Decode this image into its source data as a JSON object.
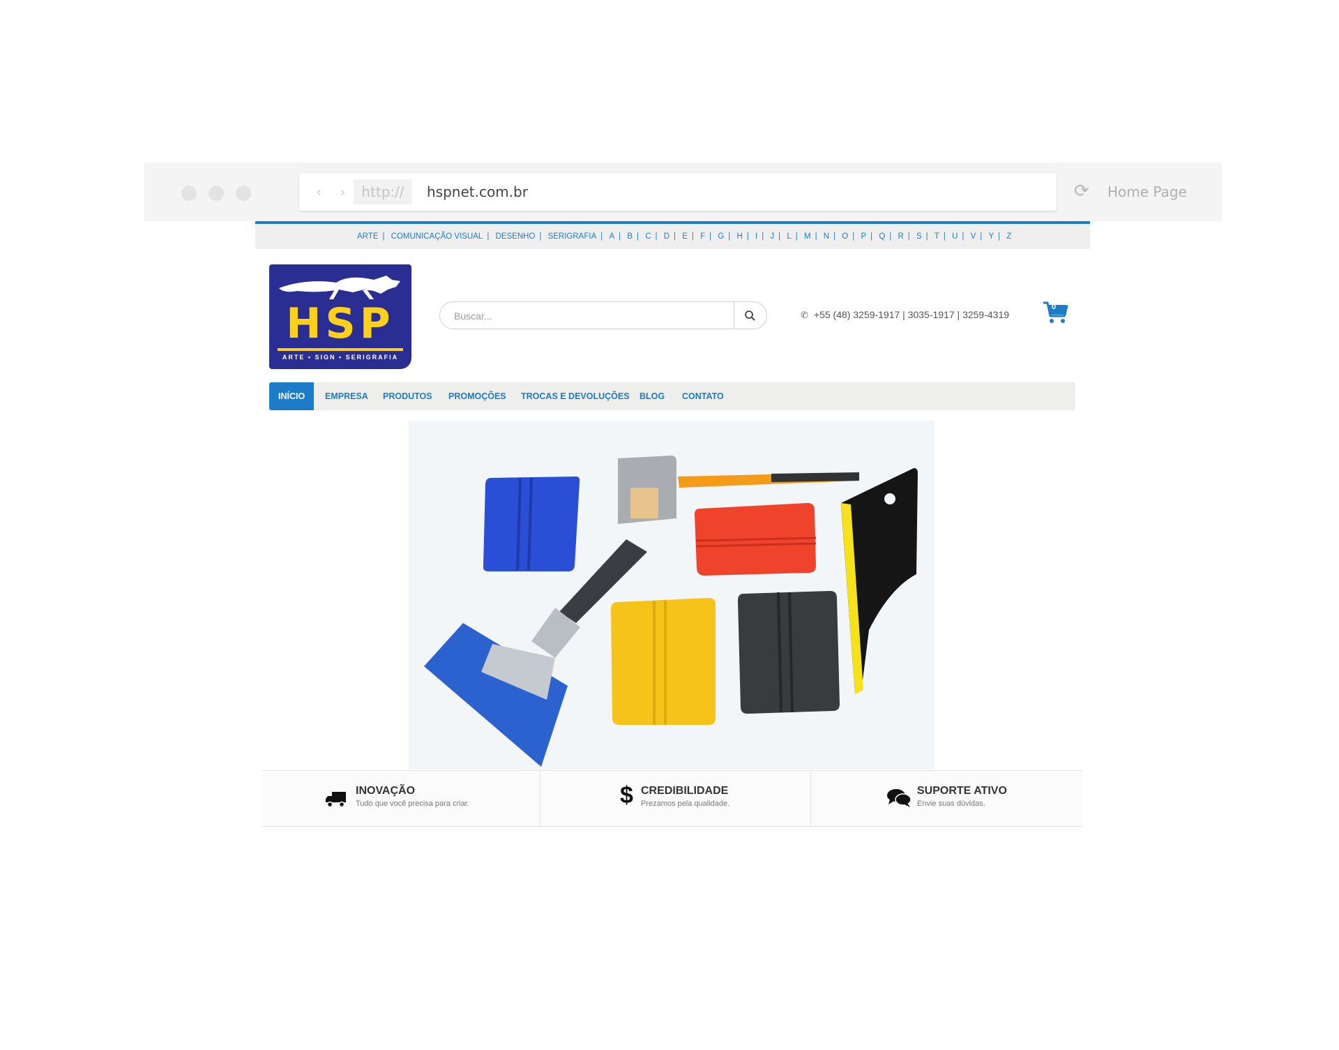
{
  "browser": {
    "nav_arrows": "‹ ›",
    "protocol": "http://",
    "url": "hspnet.com.br",
    "home_label": "Home Page"
  },
  "top_menu": {
    "items": [
      "ARTE",
      "COMUNICAÇÃO VISUAL",
      "DESENHO",
      "SERIGRAFIA",
      "A",
      "B",
      "C",
      "D",
      "E",
      "F",
      "G",
      "H",
      "I",
      "J",
      "L",
      "M",
      "N",
      "O",
      "P",
      "Q",
      "R",
      "S",
      "T",
      "U",
      "V",
      "Y",
      "Z"
    ],
    "color": "#1c7cc7"
  },
  "logo": {
    "text": "HSP",
    "subtitle": "ARTE • SIGN • SERIGRAFIA",
    "bg_color": "#2a2d92",
    "accent_color": "#ffd11c"
  },
  "search": {
    "placeholder": "Buscar...",
    "icon": "search-icon"
  },
  "contact": {
    "phone": "+55 (48) 3259-1917 | 3035-1917 | 3259-4319",
    "icon": "phone-icon"
  },
  "cart": {
    "count": "0",
    "icon": "shopping-cart-icon"
  },
  "main_nav": {
    "items": [
      "INÍCIO",
      "EMPRESA",
      "PRODUTOS",
      "PROMOÇÕES",
      "TROCAS E DEVOLUÇÕES",
      "BLOG",
      "CONTATO"
    ],
    "active": "INÍCIO"
  },
  "features": [
    {
      "title": "INOVAÇÃO",
      "subtitle": "Tudo que você precisa para criar.",
      "icon": "truck-icon"
    },
    {
      "title": "CREDIBILIDADE",
      "subtitle": "Prezamos pela qualidade.",
      "icon": "dollar-icon"
    },
    {
      "title": "SUPORTE ATIVO",
      "subtitle": "Envie suas dúvidas.",
      "icon": "chat-bubbles-icon"
    }
  ],
  "colors": {
    "primary": "#1c7cc7",
    "nav_bg": "#eeeeec",
    "text": "#333333"
  }
}
